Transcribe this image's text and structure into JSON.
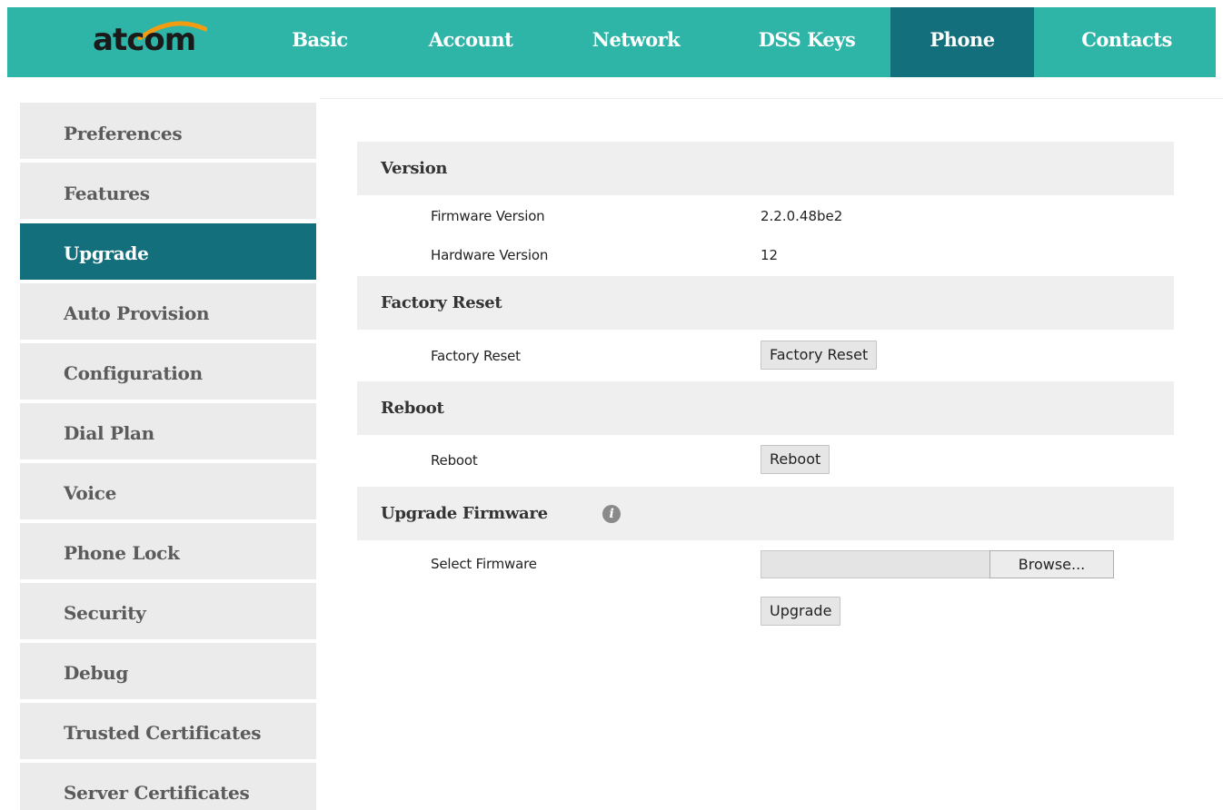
{
  "brand": {
    "logo_text": "atcom",
    "color": "#2fb5a7",
    "active_color": "#126f7b"
  },
  "nav": {
    "items": [
      {
        "label": "Basic"
      },
      {
        "label": "Account"
      },
      {
        "label": "Network"
      },
      {
        "label": "DSS Keys"
      },
      {
        "label": "Phone",
        "active": true
      },
      {
        "label": "Contacts"
      }
    ]
  },
  "sidebar": {
    "items": [
      {
        "label": "Preferences"
      },
      {
        "label": "Features"
      },
      {
        "label": "Upgrade",
        "active": true
      },
      {
        "label": "Auto Provision"
      },
      {
        "label": "Configuration"
      },
      {
        "label": "Dial Plan"
      },
      {
        "label": "Voice"
      },
      {
        "label": "Phone Lock"
      },
      {
        "label": "Security"
      },
      {
        "label": "Debug"
      },
      {
        "label": "Trusted Certificates"
      },
      {
        "label": "Server Certificates"
      }
    ]
  },
  "version": {
    "title": "Version",
    "firmware_label": "Firmware Version",
    "firmware_value": "2.2.0.48be2",
    "hardware_label": "Hardware Version",
    "hardware_value": "12"
  },
  "factory_reset": {
    "title": "Factory Reset",
    "label": "Factory Reset",
    "button": "Factory Reset"
  },
  "reboot": {
    "title": "Reboot",
    "label": "Reboot",
    "button": "Reboot"
  },
  "upgrade_firmware": {
    "title": "Upgrade Firmware",
    "info_icon": "i",
    "select_label": "Select Firmware",
    "browse_button": "Browse...",
    "upgrade_button": "Upgrade"
  }
}
